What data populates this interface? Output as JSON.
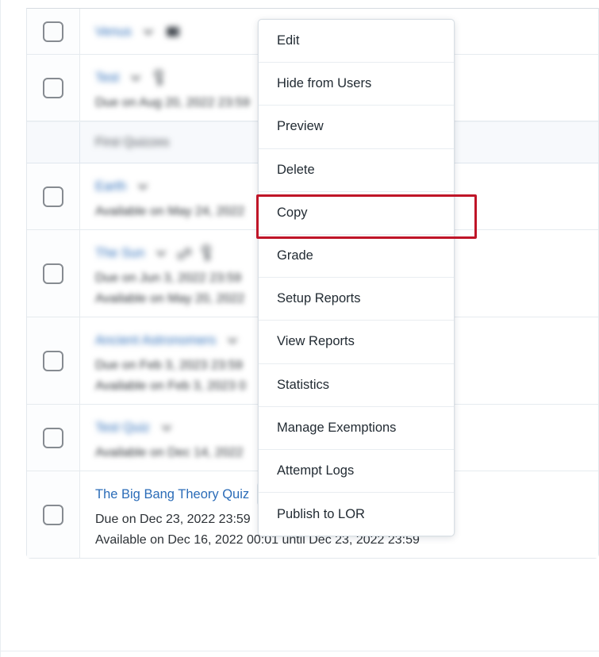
{
  "context_menu": {
    "name": "quiz-actions-menu",
    "items": [
      {
        "label": "Edit"
      },
      {
        "label": "Hide from Users"
      },
      {
        "label": "Preview"
      },
      {
        "label": "Delete"
      },
      {
        "label": "Copy"
      },
      {
        "label": "Grade"
      },
      {
        "label": "Setup Reports"
      },
      {
        "label": "View Reports"
      },
      {
        "label": "Statistics"
      },
      {
        "label": "Manage Exemptions"
      },
      {
        "label": "Attempt Logs"
      },
      {
        "label": "Publish to LOR"
      }
    ],
    "highlighted_item": "Copy"
  },
  "annotation": {
    "highlight_color": "#bf1528",
    "target_label": "Copy"
  },
  "quiz_list": {
    "rows": [
      {
        "kind": "quiz",
        "redacted": true,
        "title": "Venus",
        "has_chevron": true,
        "icons": [
          "attachment-icon"
        ],
        "meta": []
      },
      {
        "kind": "quiz",
        "redacted": true,
        "title": "Test",
        "has_chevron": true,
        "icons": [
          "key-icon"
        ],
        "meta": [
          "Due on Aug 20, 2022 23:59"
        ]
      },
      {
        "kind": "section",
        "redacted": true,
        "title": "First Quizzes",
        "has_chevron": false,
        "icons": [],
        "meta": []
      },
      {
        "kind": "quiz",
        "redacted": true,
        "title": "Earth",
        "has_chevron": true,
        "icons": [],
        "meta": [
          "Available on May 24, 2022"
        ]
      },
      {
        "kind": "quiz",
        "redacted": true,
        "title": "The Sun",
        "has_chevron": true,
        "icons": [
          "link-icon",
          "key-icon"
        ],
        "meta": [
          "Due on Jun 3, 2022 23:59",
          "Available on May 20, 2022"
        ]
      },
      {
        "kind": "quiz",
        "redacted": true,
        "title": "Ancient Astronomers",
        "has_chevron": true,
        "icons": [],
        "meta": [
          "Due on Feb 3, 2023 23:59",
          "Available on Feb 3, 2023 0"
        ]
      },
      {
        "kind": "quiz",
        "redacted": true,
        "title": "Test Quiz",
        "has_chevron": true,
        "icons": [],
        "meta": [
          "Available on Dec 14, 2022"
        ]
      },
      {
        "kind": "quiz",
        "redacted": false,
        "title": "The Big Bang Theory Quiz",
        "has_chevron": true,
        "icons": [],
        "meta": [
          "Due on Dec 23, 2022 23:59",
          "Available on Dec 16, 2022 00:01 until Dec 23, 2022 23:59"
        ]
      }
    ]
  },
  "colors": {
    "link": "#2b6cb8",
    "text": "#2d3237",
    "menu_text": "#222b33",
    "row_border": "#e6ebef",
    "band_bg": "#f7f9fc",
    "chevron_btn_bg": "#e2e8ef",
    "highlight_red": "#bf1528"
  }
}
